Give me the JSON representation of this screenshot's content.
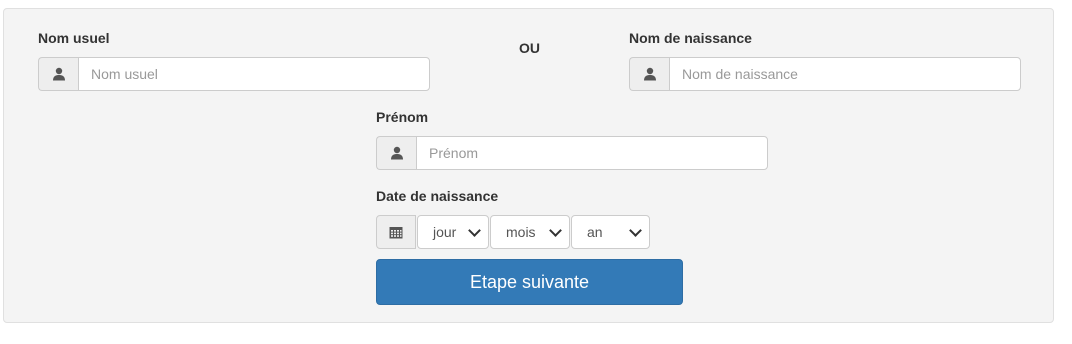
{
  "form": {
    "nom_usuel": {
      "label": "Nom usuel",
      "placeholder": "Nom usuel",
      "icon": "user-icon"
    },
    "separator": "OU",
    "nom_naissance": {
      "label": "Nom de naissance",
      "placeholder": "Nom de naissance",
      "icon": "user-icon"
    },
    "prenom": {
      "label": "Prénom",
      "placeholder": "Prénom",
      "icon": "user-icon"
    },
    "date_naissance": {
      "label": "Date de naissance",
      "icon": "calendar-icon",
      "jour": "jour",
      "mois": "mois",
      "an": "an"
    },
    "submit_label": "Etape suivante"
  },
  "colors": {
    "primary": "#337ab7",
    "panel_bg": "#f4f4f4",
    "addon_bg": "#eeeeee"
  }
}
